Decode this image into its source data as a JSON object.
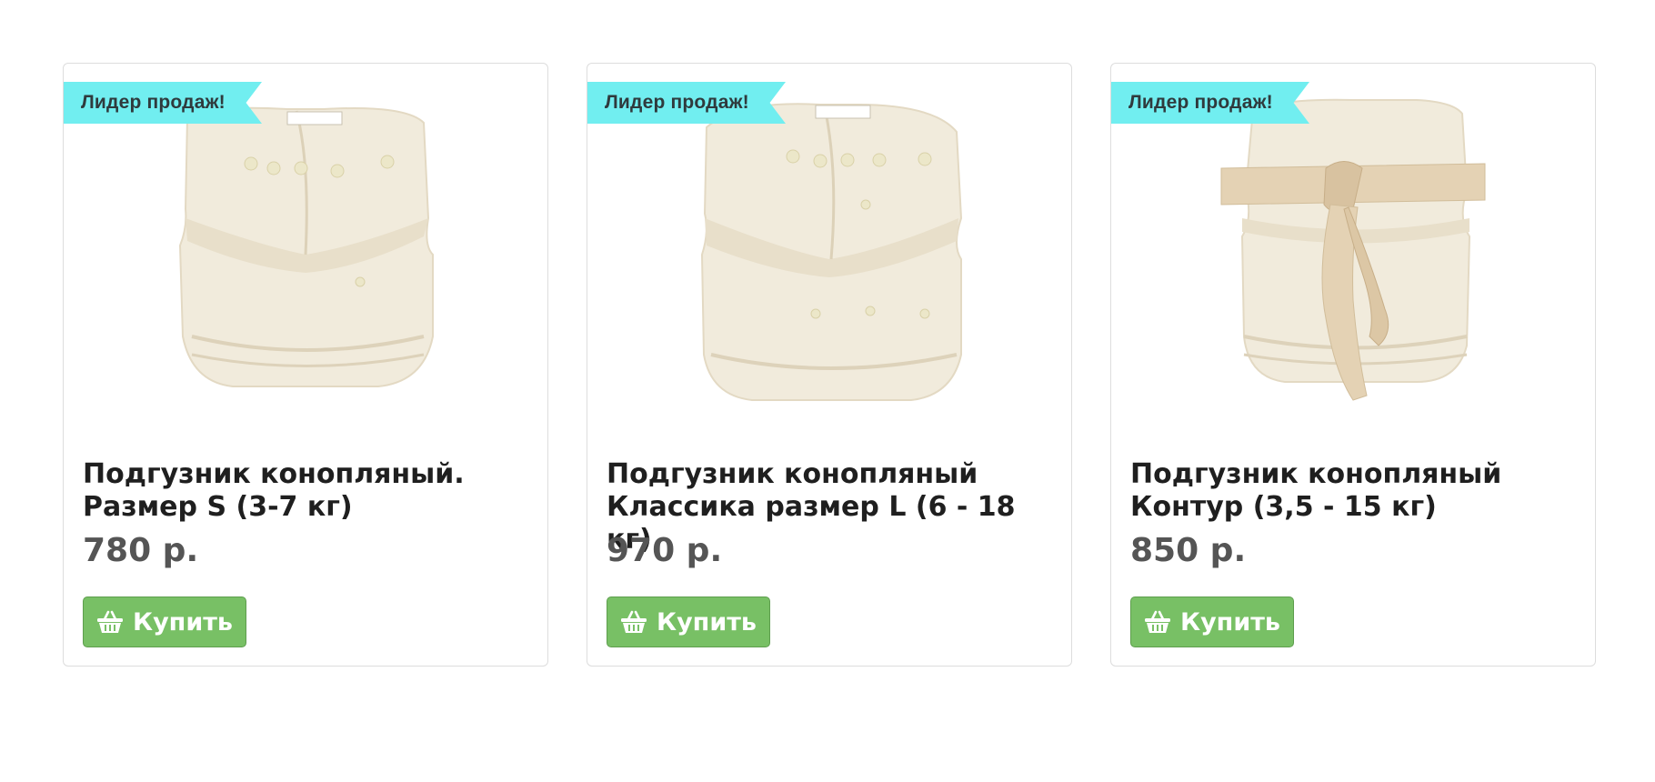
{
  "products": [
    {
      "badge": "Лидер продаж!",
      "title": "Подгузник конопляный. Размер S (3-7 кг)",
      "price": "780 р.",
      "buy_label": "Купить",
      "image": "cloth-diaper-snaps-small"
    },
    {
      "badge": "Лидер продаж!",
      "title": "Подгузник конопляный Классика размер L (6 - 18 кг)",
      "price": "970 р.",
      "buy_label": "Купить",
      "image": "cloth-diaper-snaps-large"
    },
    {
      "badge": "Лидер продаж!",
      "title": "Подгузник конопляный Контур (3,5 - 15 кг)",
      "price": "850 р.",
      "buy_label": "Купить",
      "image": "cloth-diaper-ties"
    }
  ],
  "icons": {
    "buy": "basket-icon"
  },
  "colors": {
    "badge_bg": "#71eef0",
    "button_bg": "#78c065",
    "price": "#555555",
    "product_fabric": "#f1ebdc"
  }
}
